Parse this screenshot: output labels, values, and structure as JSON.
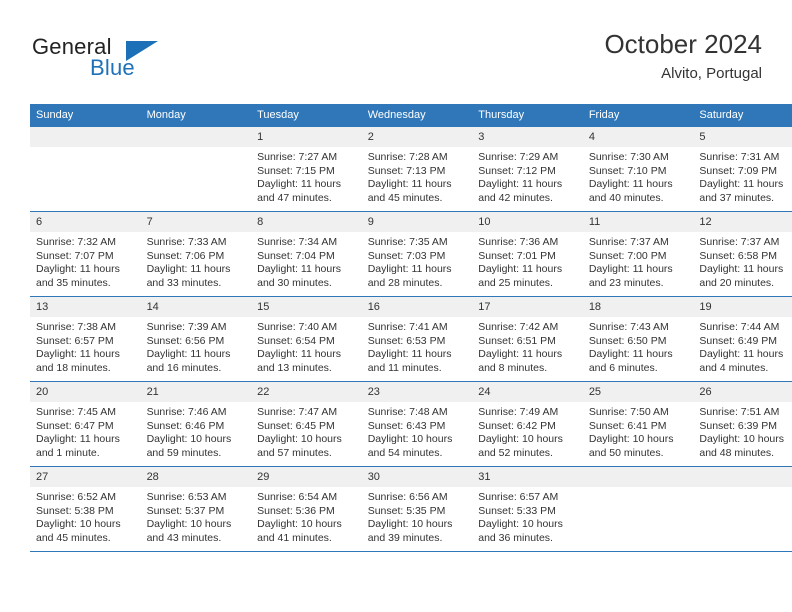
{
  "brand": {
    "name_top": "General",
    "name_bottom": "Blue",
    "accent_color": "#2072b8",
    "triangle_color": "#1c70b8"
  },
  "header": {
    "title": "October 2024",
    "subtitle": "Alvito, Portugal"
  },
  "calendar": {
    "header_bg": "#2f77b8",
    "header_text_color": "#ffffff",
    "daynum_bg": "#f0f0f0",
    "row_divider_color": "#2f77b8",
    "weekdays": [
      "Sunday",
      "Monday",
      "Tuesday",
      "Wednesday",
      "Thursday",
      "Friday",
      "Saturday"
    ],
    "weeks": [
      [
        {
          "day": "",
          "lines": []
        },
        {
          "day": "",
          "lines": []
        },
        {
          "day": "1",
          "lines": [
            "Sunrise: 7:27 AM",
            "Sunset: 7:15 PM",
            "Daylight: 11 hours",
            "and 47 minutes."
          ]
        },
        {
          "day": "2",
          "lines": [
            "Sunrise: 7:28 AM",
            "Sunset: 7:13 PM",
            "Daylight: 11 hours",
            "and 45 minutes."
          ]
        },
        {
          "day": "3",
          "lines": [
            "Sunrise: 7:29 AM",
            "Sunset: 7:12 PM",
            "Daylight: 11 hours",
            "and 42 minutes."
          ]
        },
        {
          "day": "4",
          "lines": [
            "Sunrise: 7:30 AM",
            "Sunset: 7:10 PM",
            "Daylight: 11 hours",
            "and 40 minutes."
          ]
        },
        {
          "day": "5",
          "lines": [
            "Sunrise: 7:31 AM",
            "Sunset: 7:09 PM",
            "Daylight: 11 hours",
            "and 37 minutes."
          ]
        }
      ],
      [
        {
          "day": "6",
          "lines": [
            "Sunrise: 7:32 AM",
            "Sunset: 7:07 PM",
            "Daylight: 11 hours",
            "and 35 minutes."
          ]
        },
        {
          "day": "7",
          "lines": [
            "Sunrise: 7:33 AM",
            "Sunset: 7:06 PM",
            "Daylight: 11 hours",
            "and 33 minutes."
          ]
        },
        {
          "day": "8",
          "lines": [
            "Sunrise: 7:34 AM",
            "Sunset: 7:04 PM",
            "Daylight: 11 hours",
            "and 30 minutes."
          ]
        },
        {
          "day": "9",
          "lines": [
            "Sunrise: 7:35 AM",
            "Sunset: 7:03 PM",
            "Daylight: 11 hours",
            "and 28 minutes."
          ]
        },
        {
          "day": "10",
          "lines": [
            "Sunrise: 7:36 AM",
            "Sunset: 7:01 PM",
            "Daylight: 11 hours",
            "and 25 minutes."
          ]
        },
        {
          "day": "11",
          "lines": [
            "Sunrise: 7:37 AM",
            "Sunset: 7:00 PM",
            "Daylight: 11 hours",
            "and 23 minutes."
          ]
        },
        {
          "day": "12",
          "lines": [
            "Sunrise: 7:37 AM",
            "Sunset: 6:58 PM",
            "Daylight: 11 hours",
            "and 20 minutes."
          ]
        }
      ],
      [
        {
          "day": "13",
          "lines": [
            "Sunrise: 7:38 AM",
            "Sunset: 6:57 PM",
            "Daylight: 11 hours",
            "and 18 minutes."
          ]
        },
        {
          "day": "14",
          "lines": [
            "Sunrise: 7:39 AM",
            "Sunset: 6:56 PM",
            "Daylight: 11 hours",
            "and 16 minutes."
          ]
        },
        {
          "day": "15",
          "lines": [
            "Sunrise: 7:40 AM",
            "Sunset: 6:54 PM",
            "Daylight: 11 hours",
            "and 13 minutes."
          ]
        },
        {
          "day": "16",
          "lines": [
            "Sunrise: 7:41 AM",
            "Sunset: 6:53 PM",
            "Daylight: 11 hours",
            "and 11 minutes."
          ]
        },
        {
          "day": "17",
          "lines": [
            "Sunrise: 7:42 AM",
            "Sunset: 6:51 PM",
            "Daylight: 11 hours",
            "and 8 minutes."
          ]
        },
        {
          "day": "18",
          "lines": [
            "Sunrise: 7:43 AM",
            "Sunset: 6:50 PM",
            "Daylight: 11 hours",
            "and 6 minutes."
          ]
        },
        {
          "day": "19",
          "lines": [
            "Sunrise: 7:44 AM",
            "Sunset: 6:49 PM",
            "Daylight: 11 hours",
            "and 4 minutes."
          ]
        }
      ],
      [
        {
          "day": "20",
          "lines": [
            "Sunrise: 7:45 AM",
            "Sunset: 6:47 PM",
            "Daylight: 11 hours",
            "and 1 minute."
          ]
        },
        {
          "day": "21",
          "lines": [
            "Sunrise: 7:46 AM",
            "Sunset: 6:46 PM",
            "Daylight: 10 hours",
            "and 59 minutes."
          ]
        },
        {
          "day": "22",
          "lines": [
            "Sunrise: 7:47 AM",
            "Sunset: 6:45 PM",
            "Daylight: 10 hours",
            "and 57 minutes."
          ]
        },
        {
          "day": "23",
          "lines": [
            "Sunrise: 7:48 AM",
            "Sunset: 6:43 PM",
            "Daylight: 10 hours",
            "and 54 minutes."
          ]
        },
        {
          "day": "24",
          "lines": [
            "Sunrise: 7:49 AM",
            "Sunset: 6:42 PM",
            "Daylight: 10 hours",
            "and 52 minutes."
          ]
        },
        {
          "day": "25",
          "lines": [
            "Sunrise: 7:50 AM",
            "Sunset: 6:41 PM",
            "Daylight: 10 hours",
            "and 50 minutes."
          ]
        },
        {
          "day": "26",
          "lines": [
            "Sunrise: 7:51 AM",
            "Sunset: 6:39 PM",
            "Daylight: 10 hours",
            "and 48 minutes."
          ]
        }
      ],
      [
        {
          "day": "27",
          "lines": [
            "Sunrise: 6:52 AM",
            "Sunset: 5:38 PM",
            "Daylight: 10 hours",
            "and 45 minutes."
          ]
        },
        {
          "day": "28",
          "lines": [
            "Sunrise: 6:53 AM",
            "Sunset: 5:37 PM",
            "Daylight: 10 hours",
            "and 43 minutes."
          ]
        },
        {
          "day": "29",
          "lines": [
            "Sunrise: 6:54 AM",
            "Sunset: 5:36 PM",
            "Daylight: 10 hours",
            "and 41 minutes."
          ]
        },
        {
          "day": "30",
          "lines": [
            "Sunrise: 6:56 AM",
            "Sunset: 5:35 PM",
            "Daylight: 10 hours",
            "and 39 minutes."
          ]
        },
        {
          "day": "31",
          "lines": [
            "Sunrise: 6:57 AM",
            "Sunset: 5:33 PM",
            "Daylight: 10 hours",
            "and 36 minutes."
          ]
        },
        {
          "day": "",
          "lines": []
        },
        {
          "day": "",
          "lines": []
        }
      ]
    ]
  }
}
